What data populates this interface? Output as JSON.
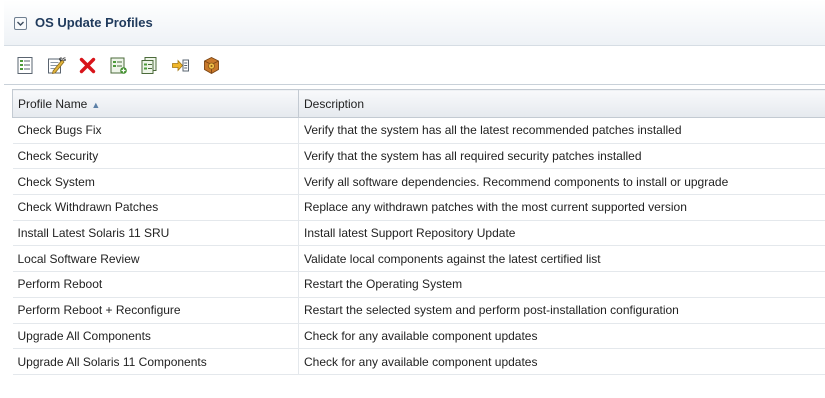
{
  "panel": {
    "title": "OS Update Profiles"
  },
  "toolbar": {
    "buttons": [
      {
        "name": "view-profile-details",
        "icon": "details-list-icon"
      },
      {
        "name": "edit-profile",
        "icon": "edit-os-icon"
      },
      {
        "name": "delete-profile",
        "icon": "delete-x-icon"
      },
      {
        "name": "create-profile",
        "icon": "new-profile-icon"
      },
      {
        "name": "copy-profile",
        "icon": "copy-profile-icon"
      },
      {
        "name": "import-profile",
        "icon": "import-arrow-icon"
      },
      {
        "name": "deploy-profile",
        "icon": "deploy-package-icon"
      }
    ]
  },
  "table": {
    "columns": {
      "name": "Profile Name",
      "description": "Description"
    },
    "sort_indicator": "▲",
    "rows": [
      {
        "name": "Check Bugs Fix",
        "description": "Verify that the system has all the latest recommended patches installed"
      },
      {
        "name": "Check Security",
        "description": "Verify that the system has all required security patches installed"
      },
      {
        "name": "Check System",
        "description": "Verify all software dependencies. Recommend components to install or upgrade"
      },
      {
        "name": "Check Withdrawn Patches",
        "description": "Replace any withdrawn patches with the most current supported version"
      },
      {
        "name": "Install Latest Solaris 11 SRU",
        "description": "Install latest Support Repository Update"
      },
      {
        "name": "Local Software Review",
        "description": "Validate local components against the latest certified list"
      },
      {
        "name": "Perform Reboot",
        "description": "Restart the Operating System"
      },
      {
        "name": "Perform Reboot + Reconfigure",
        "description": "Restart the selected system and perform post-installation configuration"
      },
      {
        "name": "Upgrade All Components",
        "description": "Check for any available component updates"
      },
      {
        "name": "Upgrade All Solaris 11 Components",
        "description": "Check for any available component updates"
      }
    ]
  }
}
